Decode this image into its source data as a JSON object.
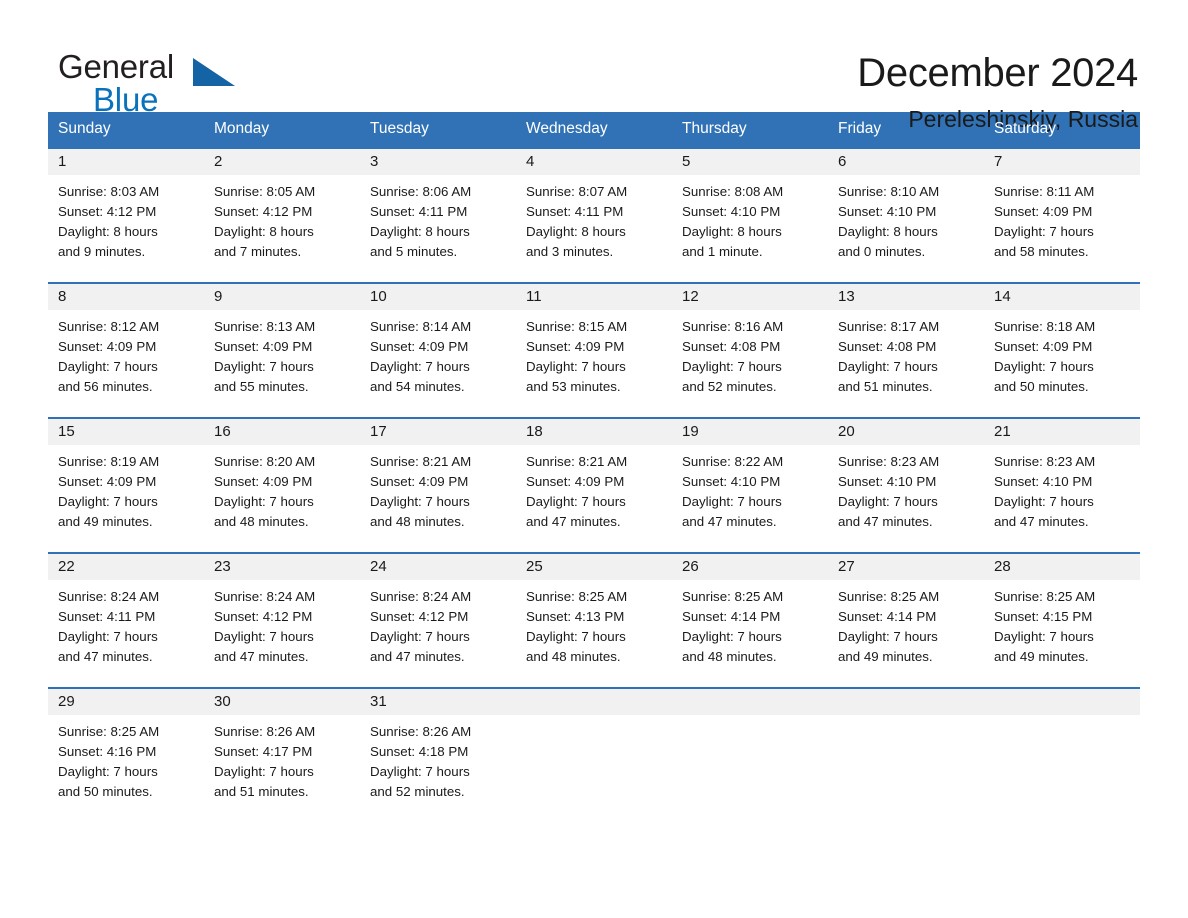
{
  "brand": {
    "name_top": "General",
    "name_bottom": "Blue",
    "triangle_color": "#1464a5",
    "blue_color": "#0a72bd"
  },
  "header": {
    "title": "December 2024",
    "subtitle": "Pereleshinskiy, Russia"
  },
  "theme": {
    "header_blue": "#3072b5",
    "daynum_band": "#f1f1f1",
    "text": "#1a1a1a"
  },
  "weekday_headers": [
    "Sunday",
    "Monday",
    "Tuesday",
    "Wednesday",
    "Thursday",
    "Friday",
    "Saturday"
  ],
  "weeks": [
    [
      {
        "day": "1",
        "sunrise": "Sunrise: 8:03 AM",
        "sunset": "Sunset: 4:12 PM",
        "daylight_line1": "Daylight: 8 hours",
        "daylight_line2": "and 9 minutes."
      },
      {
        "day": "2",
        "sunrise": "Sunrise: 8:05 AM",
        "sunset": "Sunset: 4:12 PM",
        "daylight_line1": "Daylight: 8 hours",
        "daylight_line2": "and 7 minutes."
      },
      {
        "day": "3",
        "sunrise": "Sunrise: 8:06 AM",
        "sunset": "Sunset: 4:11 PM",
        "daylight_line1": "Daylight: 8 hours",
        "daylight_line2": "and 5 minutes."
      },
      {
        "day": "4",
        "sunrise": "Sunrise: 8:07 AM",
        "sunset": "Sunset: 4:11 PM",
        "daylight_line1": "Daylight: 8 hours",
        "daylight_line2": "and 3 minutes."
      },
      {
        "day": "5",
        "sunrise": "Sunrise: 8:08 AM",
        "sunset": "Sunset: 4:10 PM",
        "daylight_line1": "Daylight: 8 hours",
        "daylight_line2": "and 1 minute."
      },
      {
        "day": "6",
        "sunrise": "Sunrise: 8:10 AM",
        "sunset": "Sunset: 4:10 PM",
        "daylight_line1": "Daylight: 8 hours",
        "daylight_line2": "and 0 minutes."
      },
      {
        "day": "7",
        "sunrise": "Sunrise: 8:11 AM",
        "sunset": "Sunset: 4:09 PM",
        "daylight_line1": "Daylight: 7 hours",
        "daylight_line2": "and 58 minutes."
      }
    ],
    [
      {
        "day": "8",
        "sunrise": "Sunrise: 8:12 AM",
        "sunset": "Sunset: 4:09 PM",
        "daylight_line1": "Daylight: 7 hours",
        "daylight_line2": "and 56 minutes."
      },
      {
        "day": "9",
        "sunrise": "Sunrise: 8:13 AM",
        "sunset": "Sunset: 4:09 PM",
        "daylight_line1": "Daylight: 7 hours",
        "daylight_line2": "and 55 minutes."
      },
      {
        "day": "10",
        "sunrise": "Sunrise: 8:14 AM",
        "sunset": "Sunset: 4:09 PM",
        "daylight_line1": "Daylight: 7 hours",
        "daylight_line2": "and 54 minutes."
      },
      {
        "day": "11",
        "sunrise": "Sunrise: 8:15 AM",
        "sunset": "Sunset: 4:09 PM",
        "daylight_line1": "Daylight: 7 hours",
        "daylight_line2": "and 53 minutes."
      },
      {
        "day": "12",
        "sunrise": "Sunrise: 8:16 AM",
        "sunset": "Sunset: 4:08 PM",
        "daylight_line1": "Daylight: 7 hours",
        "daylight_line2": "and 52 minutes."
      },
      {
        "day": "13",
        "sunrise": "Sunrise: 8:17 AM",
        "sunset": "Sunset: 4:08 PM",
        "daylight_line1": "Daylight: 7 hours",
        "daylight_line2": "and 51 minutes."
      },
      {
        "day": "14",
        "sunrise": "Sunrise: 8:18 AM",
        "sunset": "Sunset: 4:09 PM",
        "daylight_line1": "Daylight: 7 hours",
        "daylight_line2": "and 50 minutes."
      }
    ],
    [
      {
        "day": "15",
        "sunrise": "Sunrise: 8:19 AM",
        "sunset": "Sunset: 4:09 PM",
        "daylight_line1": "Daylight: 7 hours",
        "daylight_line2": "and 49 minutes."
      },
      {
        "day": "16",
        "sunrise": "Sunrise: 8:20 AM",
        "sunset": "Sunset: 4:09 PM",
        "daylight_line1": "Daylight: 7 hours",
        "daylight_line2": "and 48 minutes."
      },
      {
        "day": "17",
        "sunrise": "Sunrise: 8:21 AM",
        "sunset": "Sunset: 4:09 PM",
        "daylight_line1": "Daylight: 7 hours",
        "daylight_line2": "and 48 minutes."
      },
      {
        "day": "18",
        "sunrise": "Sunrise: 8:21 AM",
        "sunset": "Sunset: 4:09 PM",
        "daylight_line1": "Daylight: 7 hours",
        "daylight_line2": "and 47 minutes."
      },
      {
        "day": "19",
        "sunrise": "Sunrise: 8:22 AM",
        "sunset": "Sunset: 4:10 PM",
        "daylight_line1": "Daylight: 7 hours",
        "daylight_line2": "and 47 minutes."
      },
      {
        "day": "20",
        "sunrise": "Sunrise: 8:23 AM",
        "sunset": "Sunset: 4:10 PM",
        "daylight_line1": "Daylight: 7 hours",
        "daylight_line2": "and 47 minutes."
      },
      {
        "day": "21",
        "sunrise": "Sunrise: 8:23 AM",
        "sunset": "Sunset: 4:10 PM",
        "daylight_line1": "Daylight: 7 hours",
        "daylight_line2": "and 47 minutes."
      }
    ],
    [
      {
        "day": "22",
        "sunrise": "Sunrise: 8:24 AM",
        "sunset": "Sunset: 4:11 PM",
        "daylight_line1": "Daylight: 7 hours",
        "daylight_line2": "and 47 minutes."
      },
      {
        "day": "23",
        "sunrise": "Sunrise: 8:24 AM",
        "sunset": "Sunset: 4:12 PM",
        "daylight_line1": "Daylight: 7 hours",
        "daylight_line2": "and 47 minutes."
      },
      {
        "day": "24",
        "sunrise": "Sunrise: 8:24 AM",
        "sunset": "Sunset: 4:12 PM",
        "daylight_line1": "Daylight: 7 hours",
        "daylight_line2": "and 47 minutes."
      },
      {
        "day": "25",
        "sunrise": "Sunrise: 8:25 AM",
        "sunset": "Sunset: 4:13 PM",
        "daylight_line1": "Daylight: 7 hours",
        "daylight_line2": "and 48 minutes."
      },
      {
        "day": "26",
        "sunrise": "Sunrise: 8:25 AM",
        "sunset": "Sunset: 4:14 PM",
        "daylight_line1": "Daylight: 7 hours",
        "daylight_line2": "and 48 minutes."
      },
      {
        "day": "27",
        "sunrise": "Sunrise: 8:25 AM",
        "sunset": "Sunset: 4:14 PM",
        "daylight_line1": "Daylight: 7 hours",
        "daylight_line2": "and 49 minutes."
      },
      {
        "day": "28",
        "sunrise": "Sunrise: 8:25 AM",
        "sunset": "Sunset: 4:15 PM",
        "daylight_line1": "Daylight: 7 hours",
        "daylight_line2": "and 49 minutes."
      }
    ],
    [
      {
        "day": "29",
        "sunrise": "Sunrise: 8:25 AM",
        "sunset": "Sunset: 4:16 PM",
        "daylight_line1": "Daylight: 7 hours",
        "daylight_line2": "and 50 minutes."
      },
      {
        "day": "30",
        "sunrise": "Sunrise: 8:26 AM",
        "sunset": "Sunset: 4:17 PM",
        "daylight_line1": "Daylight: 7 hours",
        "daylight_line2": "and 51 minutes."
      },
      {
        "day": "31",
        "sunrise": "Sunrise: 8:26 AM",
        "sunset": "Sunset: 4:18 PM",
        "daylight_line1": "Daylight: 7 hours",
        "daylight_line2": "and 52 minutes."
      },
      {
        "day": "",
        "sunrise": "",
        "sunset": "",
        "daylight_line1": "",
        "daylight_line2": ""
      },
      {
        "day": "",
        "sunrise": "",
        "sunset": "",
        "daylight_line1": "",
        "daylight_line2": ""
      },
      {
        "day": "",
        "sunrise": "",
        "sunset": "",
        "daylight_line1": "",
        "daylight_line2": ""
      },
      {
        "day": "",
        "sunrise": "",
        "sunset": "",
        "daylight_line1": "",
        "daylight_line2": ""
      }
    ]
  ]
}
